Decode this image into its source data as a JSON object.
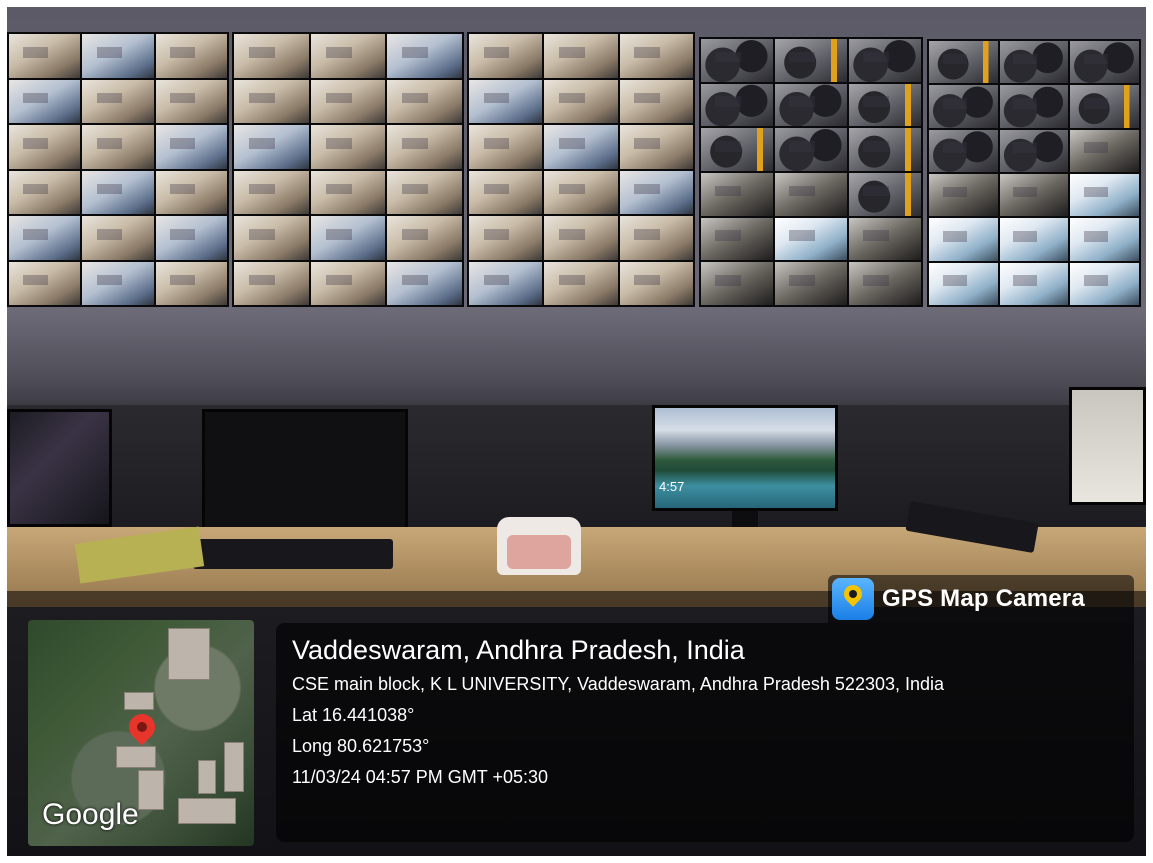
{
  "badge": {
    "label": "GPS Map Camera",
    "icon": "map-pin-icon"
  },
  "map": {
    "provider_logo": "Google",
    "marker_icon": "location-marker-icon"
  },
  "location": {
    "title": "Vaddeswaram, Andhra Pradesh, India",
    "address": "CSE main block, K L UNIVERSITY, Vaddeswaram, Andhra Pradesh 522303, India",
    "latitude": "Lat 16.441038°",
    "longitude": "Long 80.621753°",
    "timestamp": "11/03/24 04:57 PM GMT +05:30"
  },
  "scene": {
    "lockscreen_time": "4:57"
  },
  "colors": {
    "badge_bg": "#000000",
    "marker": "#e8352c",
    "pin_badge": "#1a7ee6"
  }
}
